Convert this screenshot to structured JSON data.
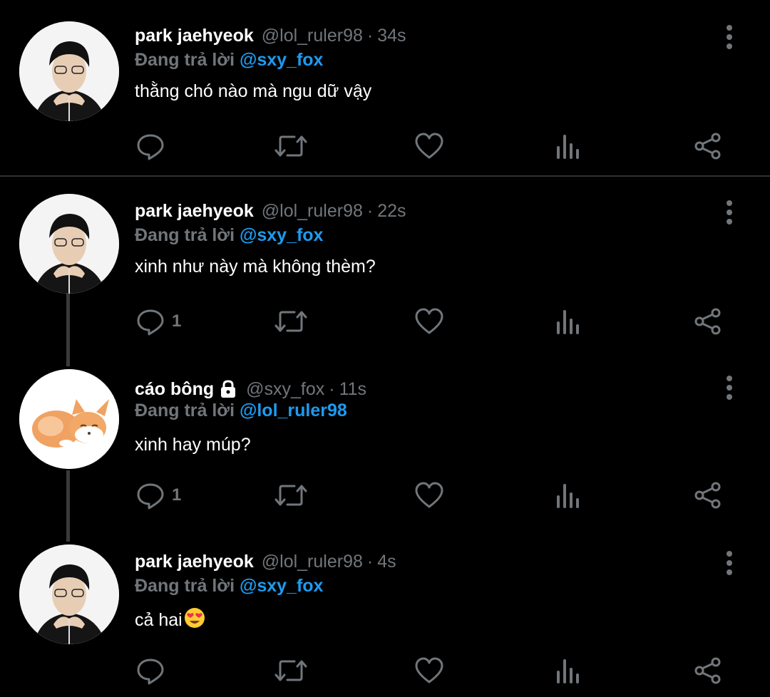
{
  "colors": {
    "background": "#000000",
    "muted": "#71767b",
    "mention": "#1d9bf0",
    "thread_line": "#3a3a3a"
  },
  "icons": {
    "reply": "speech-bubble-icon",
    "retweet": "retweet-arrows-icon",
    "like": "heart-icon",
    "views": "bar-chart-icon",
    "share": "share-icon",
    "more": "vertical-dots-icon",
    "lock": "lock-icon"
  },
  "tweets": [
    {
      "name": "park jaehyeok",
      "handle": "@lol_ruler98",
      "time": "34s",
      "reply_prefix": "Đang trả lời",
      "reply_to": "@sxy_fox",
      "text": "thằng chó nào mà ngu dữ vậy",
      "reply_count": ""
    },
    {
      "name": "park jaehyeok",
      "handle": "@lol_ruler98",
      "time": "22s",
      "reply_prefix": "Đang trả lời",
      "reply_to": "@sxy_fox",
      "text": "xinh như này mà không thèm?",
      "reply_count": "1"
    },
    {
      "name": "cáo bông",
      "handle": "@sxy_fox",
      "time": "11s",
      "reply_prefix": "Đang trả lời",
      "reply_to": "@lol_ruler98",
      "text": "xinh hay múp?",
      "reply_count": "1"
    },
    {
      "name": "park jaehyeok",
      "handle": "@lol_ruler98",
      "time": "4s",
      "reply_prefix": "Đang trả lời",
      "reply_to": "@sxy_fox",
      "text": "cả hai",
      "reply_count": ""
    }
  ]
}
